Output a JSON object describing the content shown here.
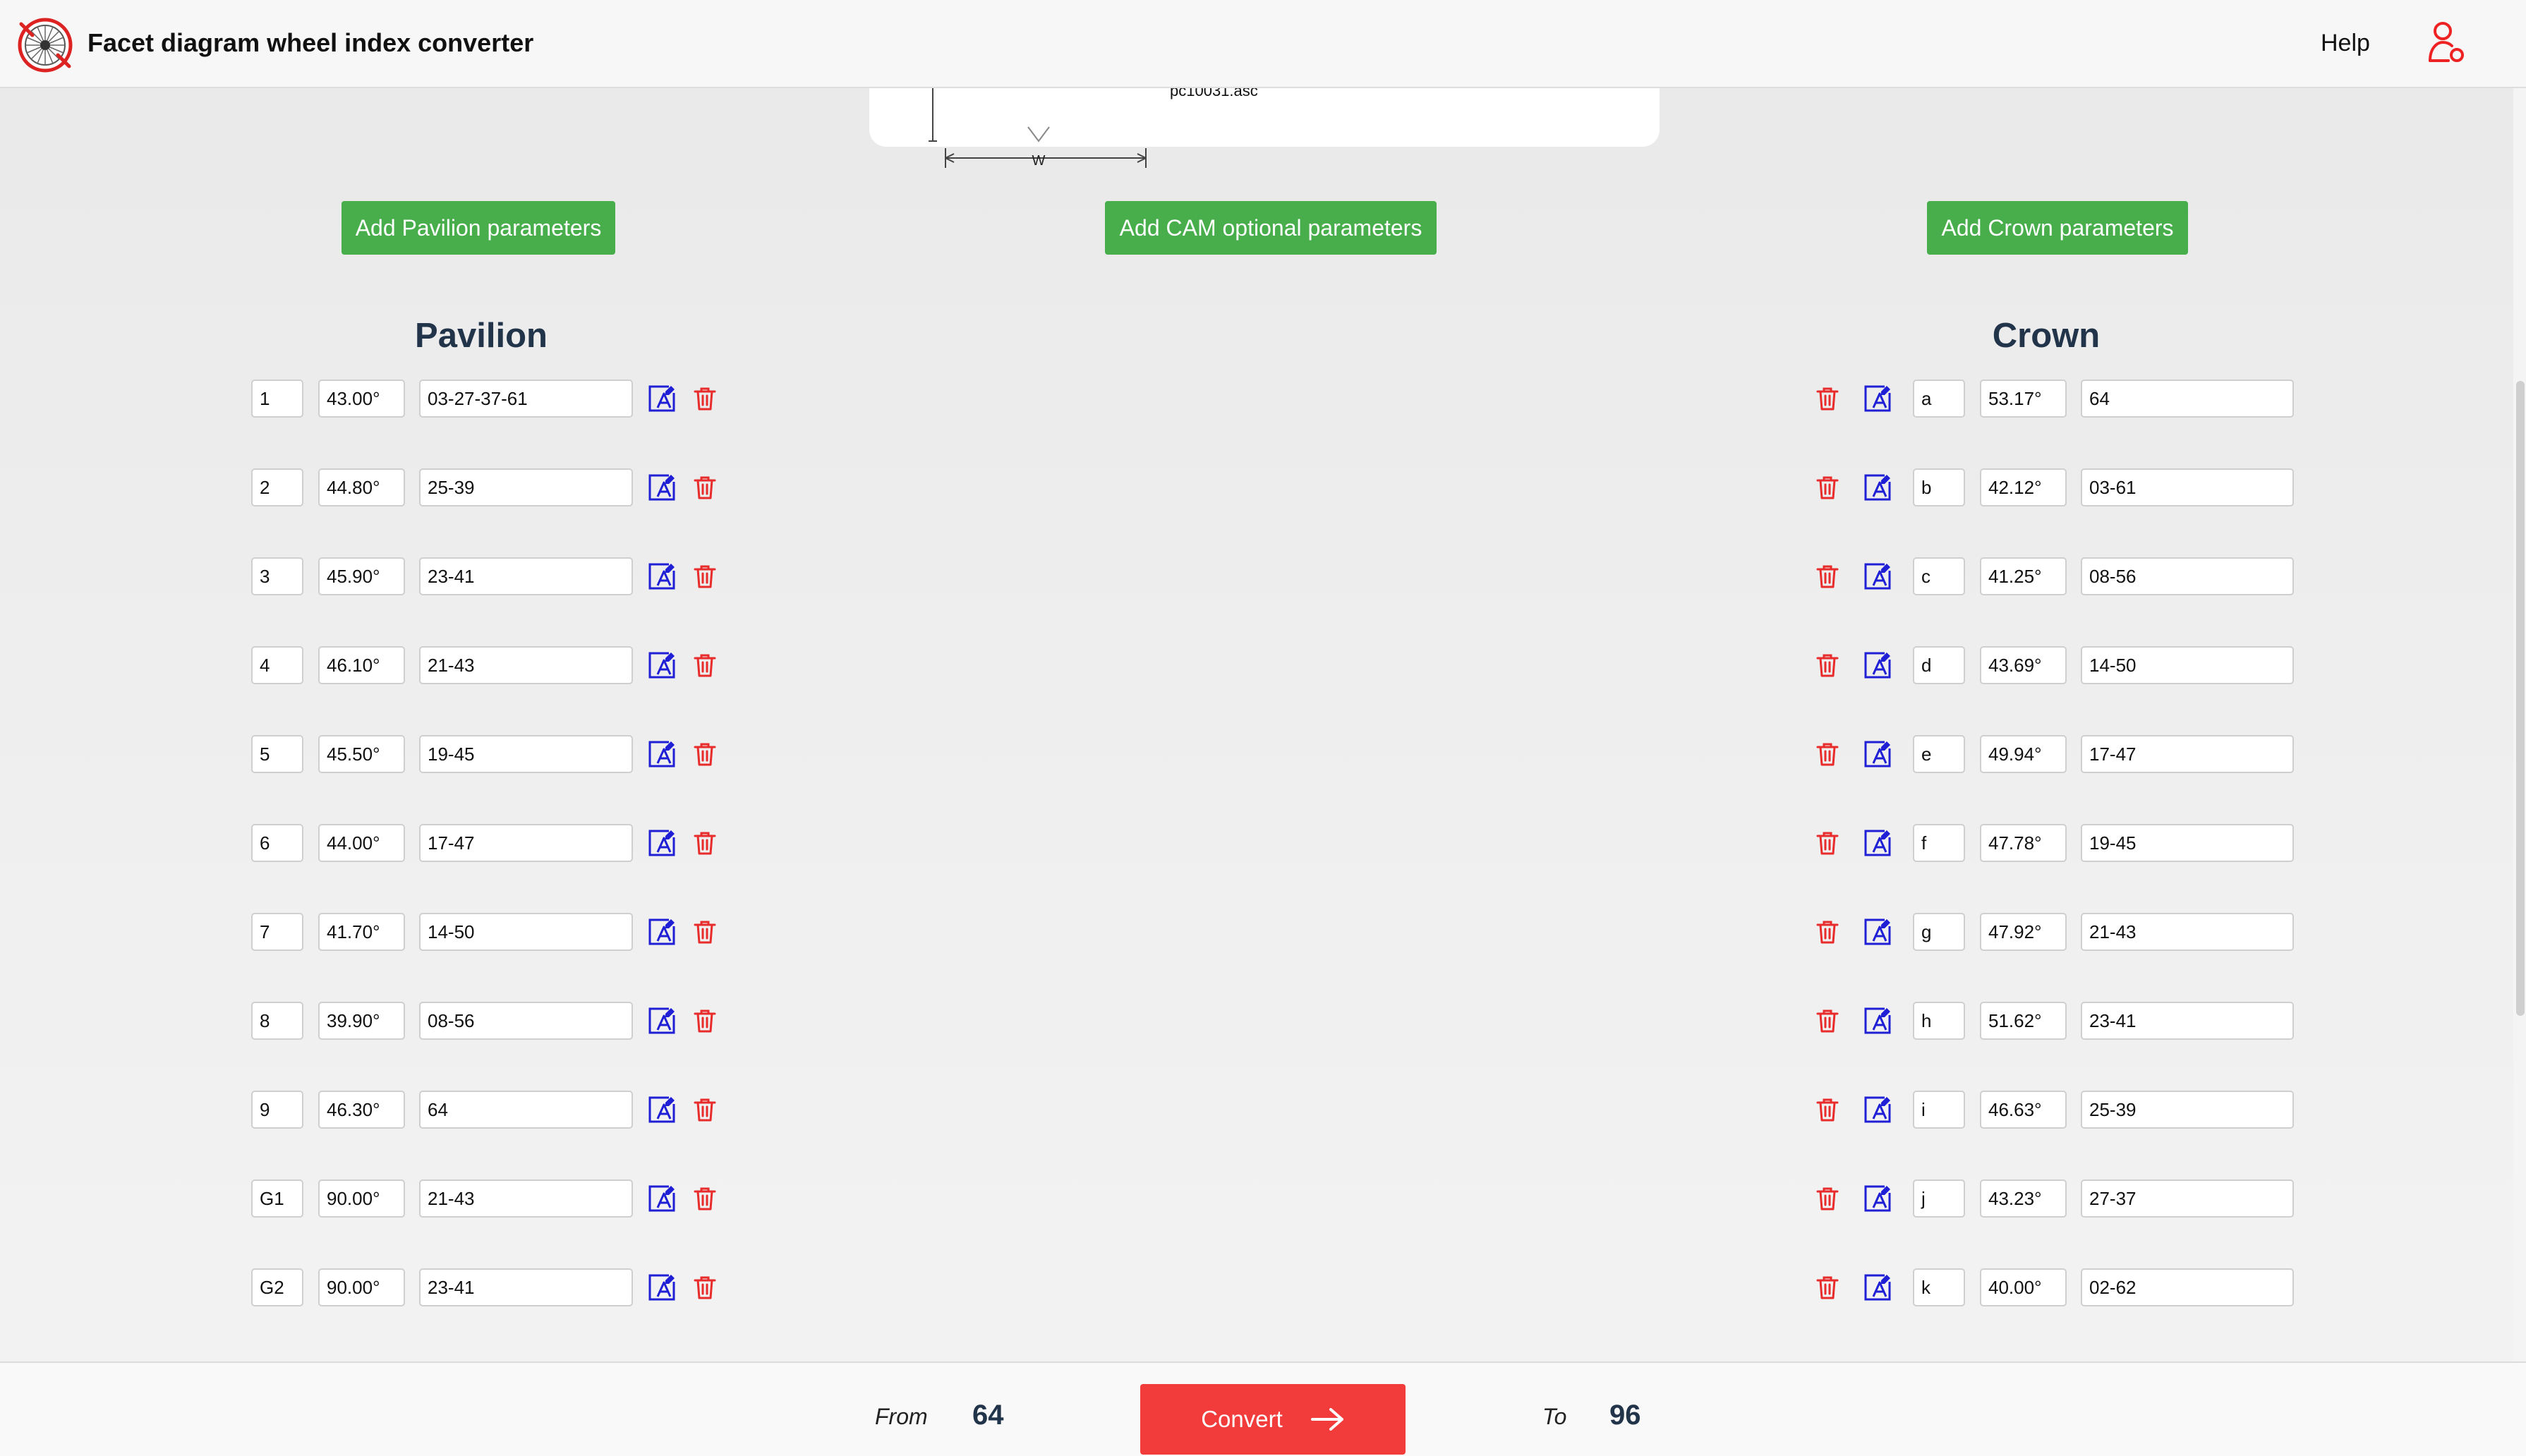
{
  "header": {
    "title": "Facet diagram wheel index converter",
    "help_label": "Help",
    "logo_icon": "wheel-logo-icon",
    "user_icon": "user-settings-icon"
  },
  "diagram": {
    "filename": "pc10031.asc",
    "width_label": "W"
  },
  "buttons": {
    "add_pavilion": "Add Pavilion parameters",
    "add_cam": "Add CAM optional parameters",
    "add_crown": "Add Crown parameters"
  },
  "pavilion": {
    "title": "Pavilion",
    "rows": [
      {
        "id": "1",
        "angle": "43.00°",
        "index": "03-27-37-61"
      },
      {
        "id": "2",
        "angle": "44.80°",
        "index": "25-39"
      },
      {
        "id": "3",
        "angle": "45.90°",
        "index": "23-41"
      },
      {
        "id": "4",
        "angle": "46.10°",
        "index": "21-43"
      },
      {
        "id": "5",
        "angle": "45.50°",
        "index": "19-45"
      },
      {
        "id": "6",
        "angle": "44.00°",
        "index": "17-47"
      },
      {
        "id": "7",
        "angle": "41.70°",
        "index": "14-50"
      },
      {
        "id": "8",
        "angle": "39.90°",
        "index": "08-56"
      },
      {
        "id": "9",
        "angle": "46.30°",
        "index": "64"
      },
      {
        "id": "G1",
        "angle": "90.00°",
        "index": "21-43"
      },
      {
        "id": "G2",
        "angle": "90.00°",
        "index": "23-41"
      }
    ]
  },
  "crown": {
    "title": "Crown",
    "rows": [
      {
        "id": "a",
        "angle": "53.17°",
        "index": "64"
      },
      {
        "id": "b",
        "angle": "42.12°",
        "index": "03-61"
      },
      {
        "id": "c",
        "angle": "41.25°",
        "index": "08-56"
      },
      {
        "id": "d",
        "angle": "43.69°",
        "index": "14-50"
      },
      {
        "id": "e",
        "angle": "49.94°",
        "index": "17-47"
      },
      {
        "id": "f",
        "angle": "47.78°",
        "index": "19-45"
      },
      {
        "id": "g",
        "angle": "47.92°",
        "index": "21-43"
      },
      {
        "id": "h",
        "angle": "51.62°",
        "index": "23-41"
      },
      {
        "id": "i",
        "angle": "46.63°",
        "index": "25-39"
      },
      {
        "id": "j",
        "angle": "43.23°",
        "index": "27-37"
      },
      {
        "id": "k",
        "angle": "40.00°",
        "index": "02-62"
      }
    ]
  },
  "bottom": {
    "from_label": "From",
    "from_value": "64",
    "convert_label": "Convert",
    "to_label": "To",
    "to_value": "96"
  },
  "colors": {
    "green": "#48ae4c",
    "red": "#f23b3b",
    "blue_icon": "#1f1fd6",
    "title_navy": "#22344a"
  },
  "icons": {
    "row_edit": "edit-index-icon",
    "row_delete": "trash-icon",
    "convert_arrow": "arrow-right-icon"
  }
}
